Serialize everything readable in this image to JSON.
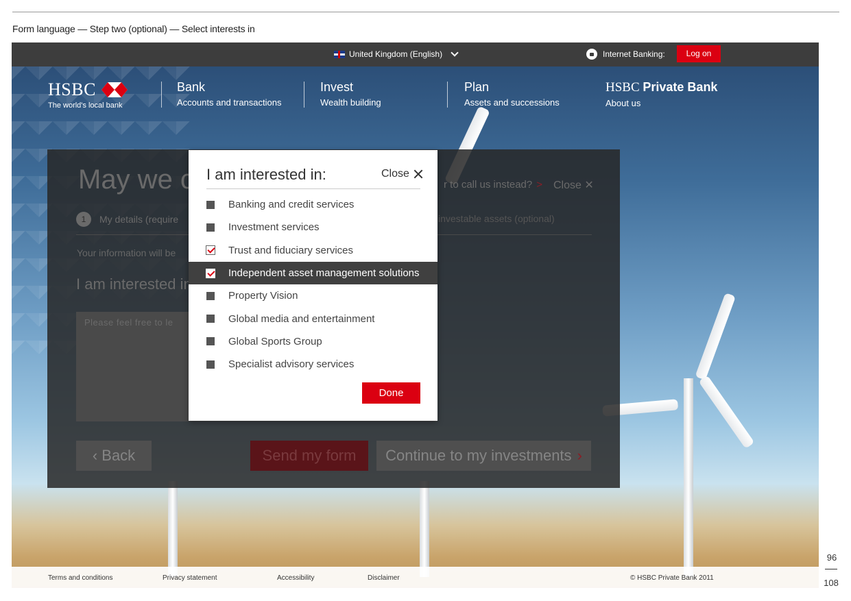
{
  "doc": {
    "caption": "Form language — Step two (optional) — Select interests in",
    "page_number": "96",
    "page_total": "108"
  },
  "util_bar": {
    "locale_label": "United Kingdom (English)",
    "internet_banking_label": "Internet Banking:",
    "logon_label": "Log on"
  },
  "brand": {
    "name": "HSBC",
    "tagline": "The world's local bank",
    "logo_color": "#db0011"
  },
  "nav": [
    {
      "title": "Bank",
      "subtitle": "Accounts and transactions"
    },
    {
      "title": "Invest",
      "subtitle": "Wealth building"
    },
    {
      "title": "Plan",
      "subtitle": "Assets and successions"
    }
  ],
  "private_bank": {
    "title_prefix": "HSBC",
    "title_bold": "Private Bank",
    "subtitle": "About us"
  },
  "form_panel": {
    "title": "May we co",
    "call_us": "r to call us instead?",
    "call_us_arrow": ">",
    "close_label": "Close ✕",
    "step_number": "1",
    "step_label": "My details (require",
    "step_three_label": "investable assets (optional)",
    "info_text": "Your information will be",
    "interest_heading": "I am interested in",
    "textarea_placeholder": "Please feel free to le",
    "back_label": "Back",
    "send_label": "Send my form",
    "continue_label": "Continue to my investments"
  },
  "modal": {
    "title": "I am interested in:",
    "close_label": "Close",
    "options": [
      {
        "label": "Banking and credit services",
        "checked": false
      },
      {
        "label": "Investment services",
        "checked": false
      },
      {
        "label": "Trust and fiduciary services",
        "checked": true
      },
      {
        "label": "Independent asset management solutions",
        "checked": true,
        "active": true
      },
      {
        "label": "Property Vision",
        "checked": false
      },
      {
        "label": "Global media and entertainment",
        "checked": false
      },
      {
        "label": "Global Sports Group",
        "checked": false
      },
      {
        "label": "Specialist advisory services",
        "checked": false
      }
    ],
    "done_label": "Done",
    "accent_color": "#db0011"
  },
  "footer": {
    "links": [
      "Terms and conditions",
      "Privacy statement",
      "Accessibility",
      "Disclaimer"
    ],
    "copyright": "© HSBC Private Bank 2011"
  },
  "icons": {
    "flag": "uk-flag-icon",
    "chevron": "chevron-down-icon",
    "lock": "lock-icon",
    "close": "close-icon",
    "check": "checkmark-icon"
  }
}
